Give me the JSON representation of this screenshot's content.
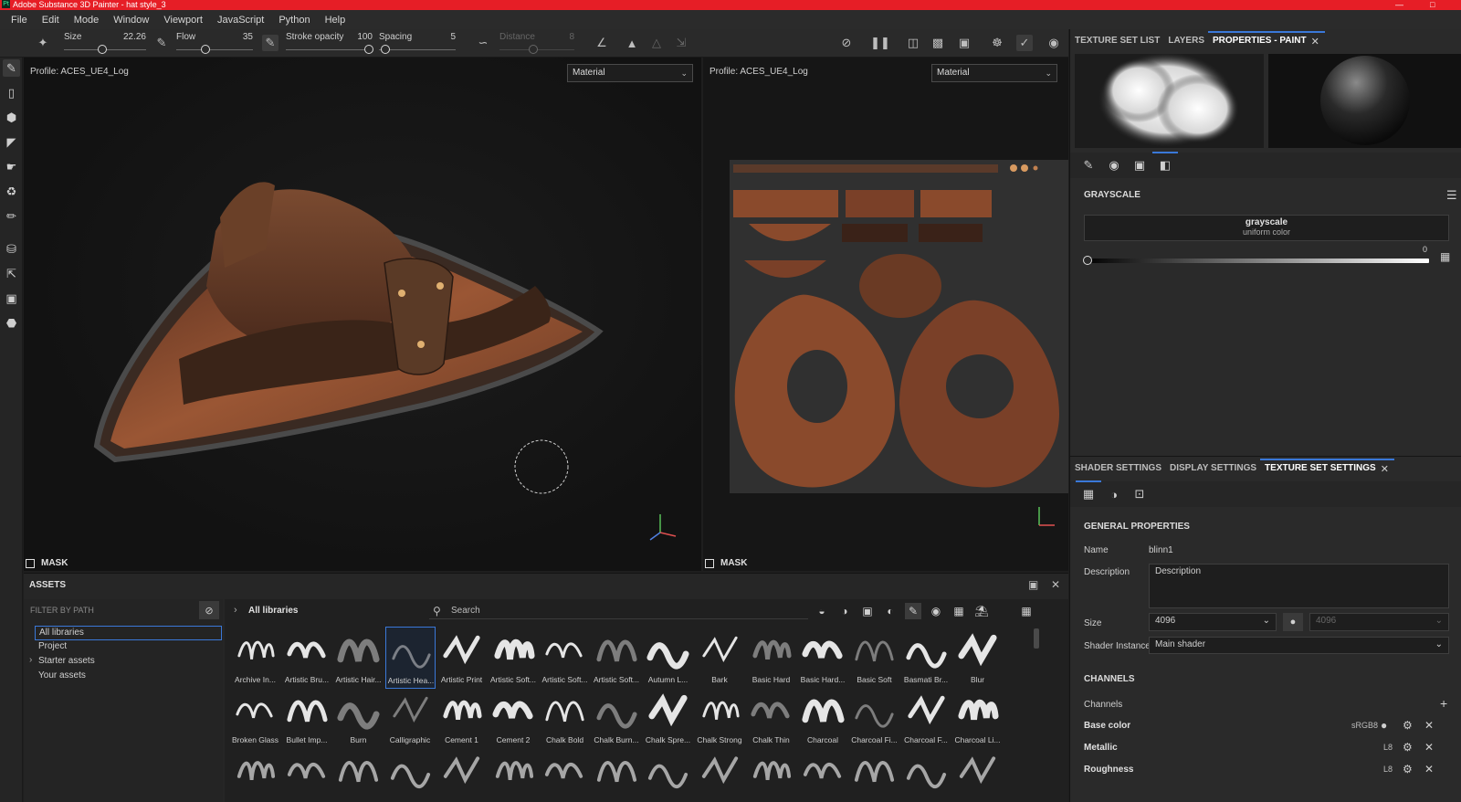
{
  "window": {
    "title": "Adobe Substance 3D Painter - hat style_3",
    "app_badge": "Pt"
  },
  "menu": [
    "File",
    "Edit",
    "Mode",
    "Window",
    "Viewport",
    "JavaScript",
    "Python",
    "Help"
  ],
  "toolbar": {
    "size": {
      "label": "Size",
      "value": "22.26"
    },
    "flow": {
      "label": "Flow",
      "value": "35"
    },
    "stroke_opacity": {
      "label": "Stroke opacity",
      "value": "100"
    },
    "spacing": {
      "label": "Spacing",
      "value": "5"
    },
    "distance": {
      "label": "Distance",
      "value": "8"
    }
  },
  "viewport3d": {
    "profile": "Profile: ACES_UE4_Log",
    "mode": "Material",
    "mask": "MASK"
  },
  "viewport2d": {
    "profile": "Profile: ACES_UE4_Log",
    "mode": "Material",
    "mask": "MASK"
  },
  "right_top_tabs": {
    "items": [
      "TEXTURE SET LIST",
      "LAYERS",
      "PROPERTIES - PAINT"
    ],
    "active": "PROPERTIES - PAINT"
  },
  "grayscale": {
    "title": "GRAYSCALE",
    "name": "grayscale",
    "subtitle": "uniform color",
    "value": "0",
    "level": 0
  },
  "right_bottom_tabs": {
    "items": [
      "SHADER SETTINGS",
      "DISPLAY SETTINGS",
      "TEXTURE SET SETTINGS"
    ],
    "active": "TEXTURE SET SETTINGS"
  },
  "general_properties": {
    "title": "GENERAL PROPERTIES",
    "name_label": "Name",
    "name_value": "blinn1",
    "description_label": "Description",
    "description_value": "Description",
    "size_label": "Size",
    "size_value": "4096",
    "size_value_locked": "4096",
    "shader_label": "Shader Instance",
    "shader_value": "Main shader"
  },
  "channels": {
    "title": "CHANNELS",
    "channels_label": "Channels",
    "items": [
      {
        "name": "Base color",
        "format": "sRGB8"
      },
      {
        "name": "Metallic",
        "format": "L8"
      },
      {
        "name": "Roughness",
        "format": "L8"
      }
    ]
  },
  "assets": {
    "title": "ASSETS",
    "filter_label": "FILTER BY PATH",
    "libraries": [
      "All libraries",
      "Project",
      "Starter assets",
      "Your assets"
    ],
    "breadcrumb": "All libraries",
    "search_placeholder": "Search",
    "row1": [
      "Archive In...",
      "Artistic Bru...",
      "Artistic Hair...",
      "Artistic Hea...",
      "Artistic Print",
      "Artistic Soft...",
      "Artistic Soft...",
      "Artistic Soft...",
      "Autumn L...",
      "Bark",
      "Basic Hard",
      "Basic Hard...",
      "Basic Soft",
      "Basmati Br...",
      "Blur"
    ],
    "row2": [
      "Broken Glass",
      "Bullet Imp...",
      "Burn",
      "Calligraphic",
      "Cement 1",
      "Cement 2",
      "Chalk Bold",
      "Chalk Burn...",
      "Chalk Spre...",
      "Chalk Strong",
      "Chalk Thin",
      "Charcoal",
      "Charcoal Fi...",
      "Charcoal F...",
      "Charcoal Li..."
    ]
  },
  "colors": {
    "accent": "#3a78d8",
    "titlebar": "#e61e26",
    "leather": "#8a4a2c"
  }
}
